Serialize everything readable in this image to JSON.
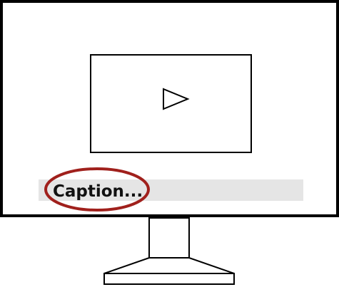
{
  "monitor": {
    "caption": {
      "text": "Caption...",
      "highlight_color": "#a0201c",
      "bar_color": "#e5e5e5"
    },
    "video_player": {
      "icon": "play-icon"
    }
  },
  "colors": {
    "outline": "#000000",
    "background": "#ffffff"
  }
}
